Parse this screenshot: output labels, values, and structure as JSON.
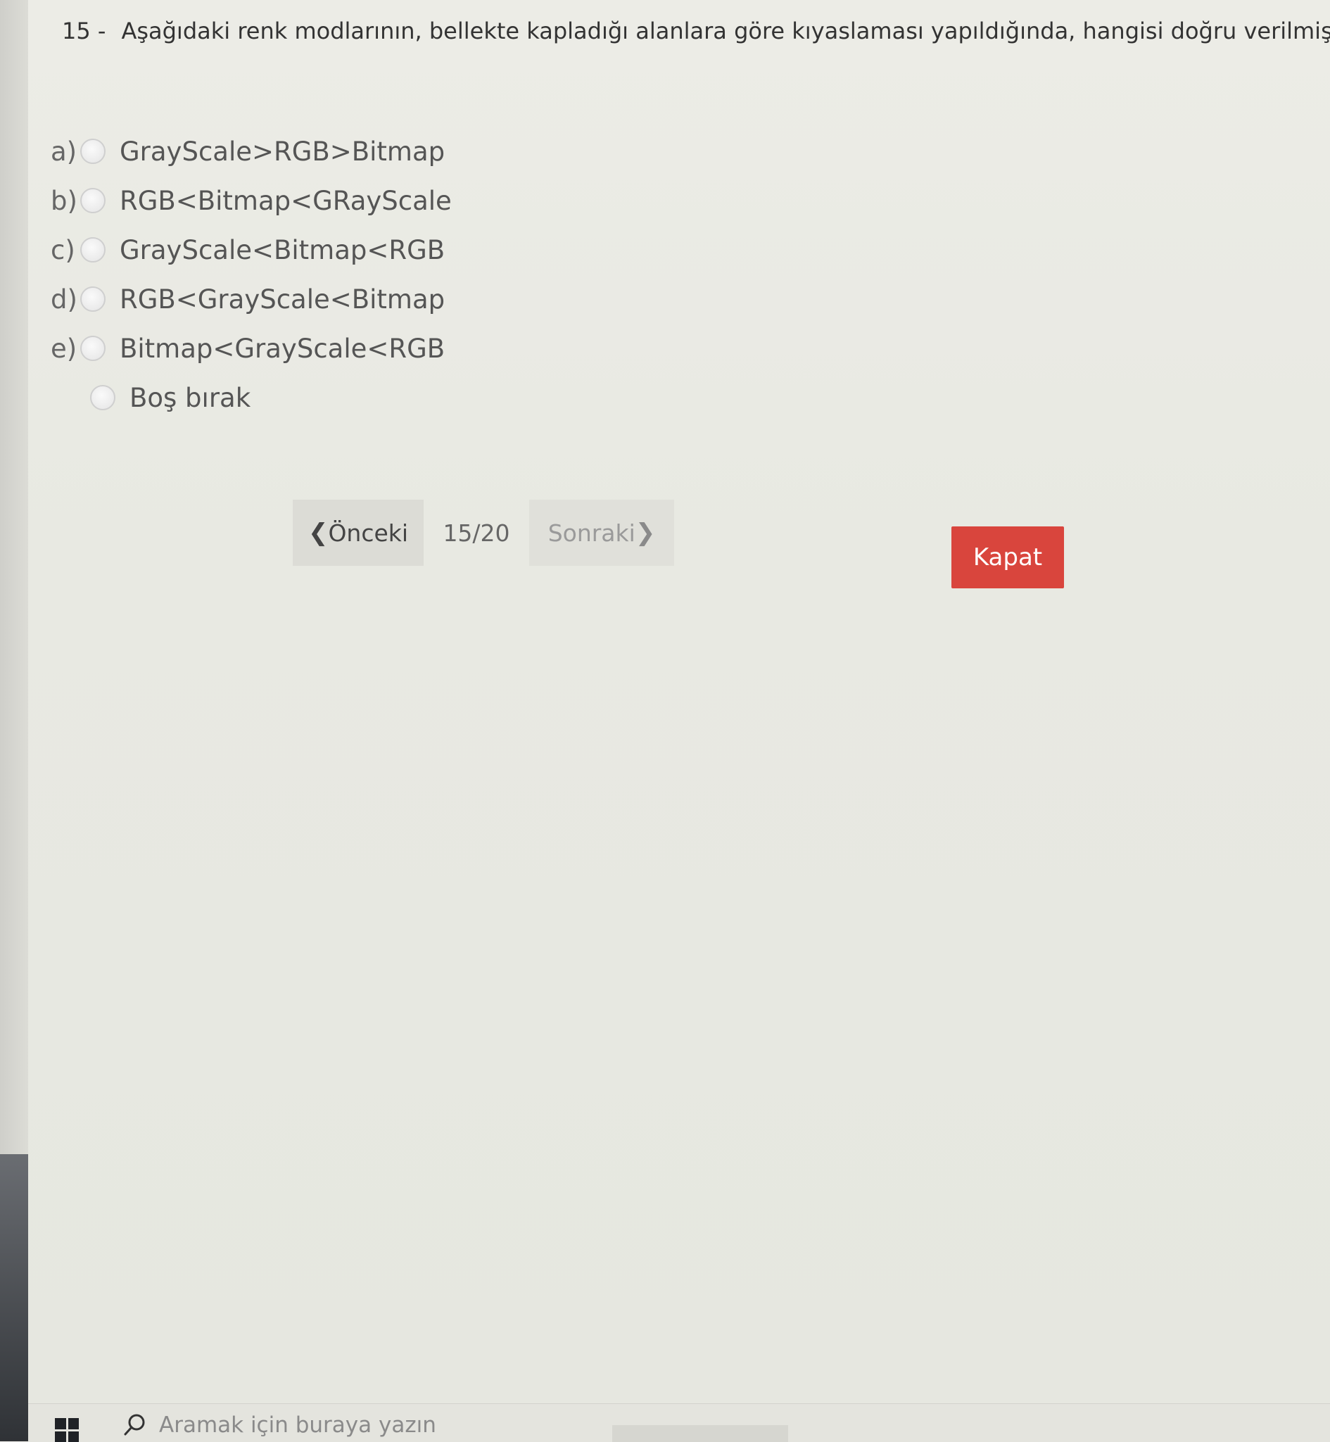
{
  "question": {
    "number": "15 -",
    "text": "Aşağıdaki renk modlarının, bellekte kapladığı alanlara göre kıyaslaması yapıldığında, hangisi doğru verilmiştir."
  },
  "options": [
    {
      "letter": "a)",
      "text": "GrayScale>RGB>Bitmap"
    },
    {
      "letter": "b)",
      "text": "RGB<Bitmap<GRayScale"
    },
    {
      "letter": "c)",
      "text": "GrayScale<Bitmap<RGB"
    },
    {
      "letter": "d)",
      "text": "RGB<GrayScale<Bitmap"
    },
    {
      "letter": "e)",
      "text": "Bitmap<GrayScale<RGB"
    }
  ],
  "blank_option": "Boş bırak",
  "pager": {
    "prev_label": "Önceki",
    "prev_chevron": "❮",
    "counter": "15/20",
    "next_label": "Sonraki",
    "next_chevron": "❯"
  },
  "close_label": "Kapat",
  "taskbar": {
    "search_placeholder": "Aramak için buraya yazın"
  },
  "colors": {
    "accent_close": "#d9453d",
    "background": "#e9e9e3"
  },
  "icons": {
    "start": "windows-start-icon",
    "search": "search-icon",
    "radio": "radio-button"
  }
}
